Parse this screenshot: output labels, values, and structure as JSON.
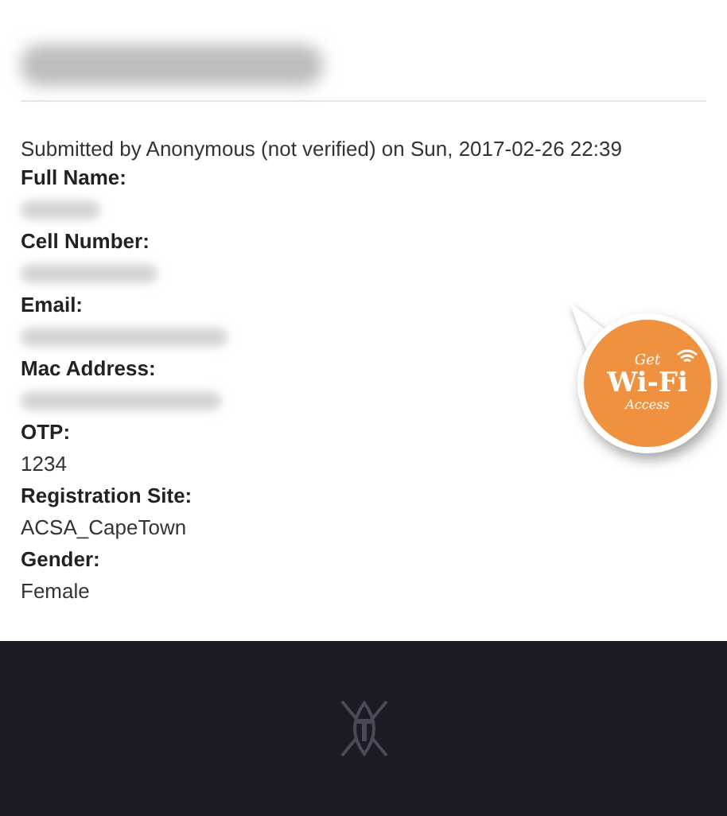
{
  "submitted": "Submitted by Anonymous (not verified) on Sun, 2017-02-26 22:39",
  "fields": [
    {
      "label": "Full Name:"
    },
    {
      "label": "Cell Number:"
    },
    {
      "label": "Email:"
    },
    {
      "label": "Mac Address:"
    },
    {
      "label": "OTP:",
      "value": "1234"
    },
    {
      "label": "Registration Site:",
      "value": "ACSA_CapeTown"
    },
    {
      "label": "Gender:",
      "value": "Female"
    }
  ],
  "wifi_badge": {
    "top": "Get",
    "main": "Wi-Fi",
    "bottom": "Access"
  }
}
